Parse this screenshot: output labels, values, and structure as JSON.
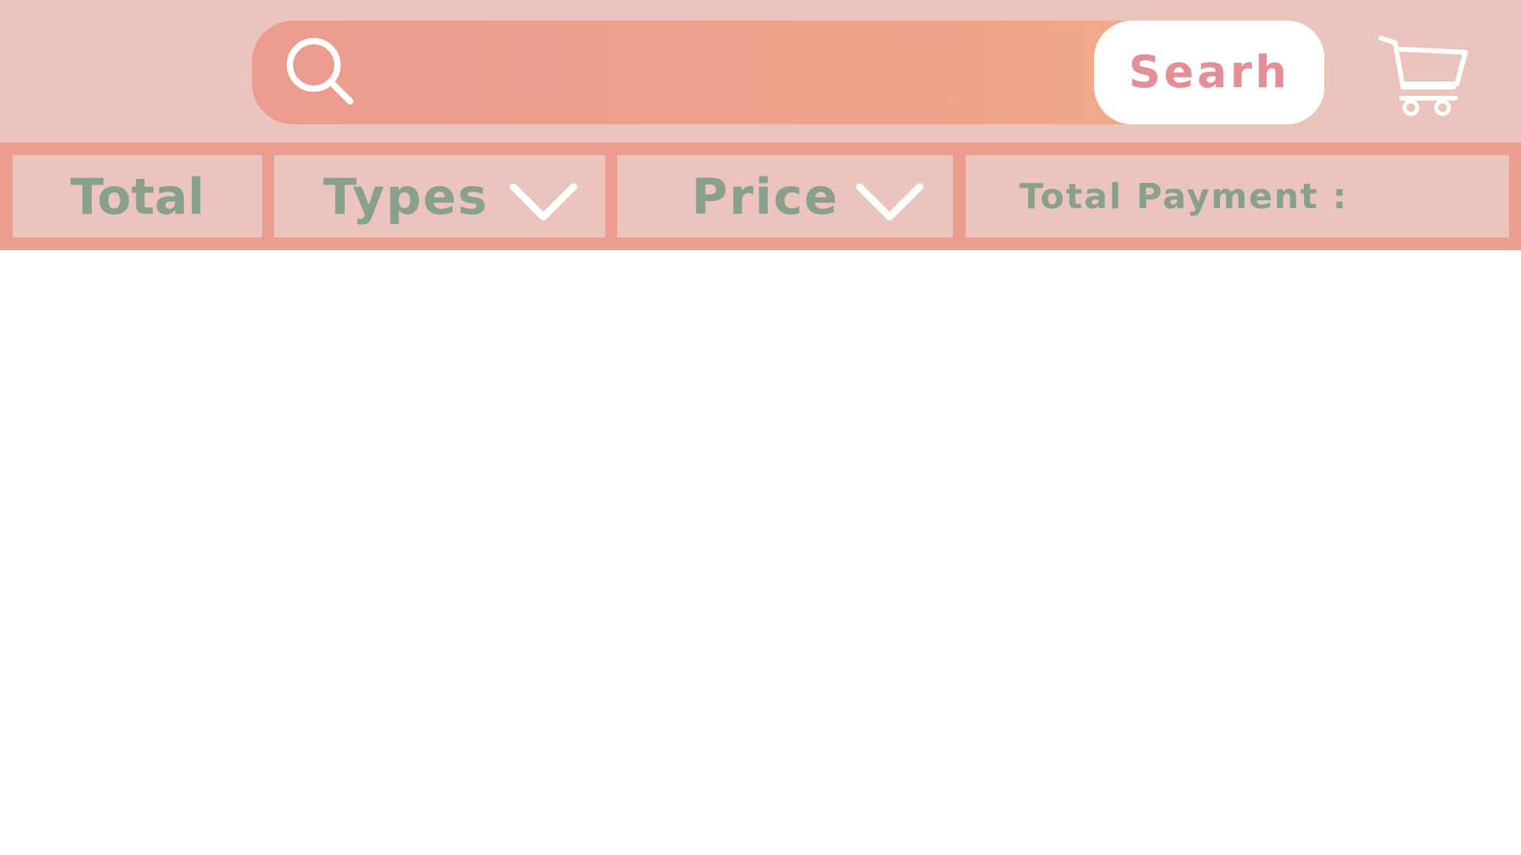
{
  "header": {
    "search": {
      "placeholder": "",
      "value": "",
      "icon": "search-icon"
    },
    "search_button_label": "Searh",
    "cart_icon": "shopping-cart-icon"
  },
  "filters": {
    "total_label": "Total",
    "types_label": "Types",
    "price_label": "Price",
    "payment_label": "Total Payment :"
  },
  "colors": {
    "header_bg": "#ebc5bd",
    "search_gradient_start": "#eb9c8e",
    "search_gradient_end": "#f4ad8a",
    "filter_bar_bg": "#eb9d90",
    "label_text": "#88a08c",
    "button_text": "#e48f96"
  }
}
